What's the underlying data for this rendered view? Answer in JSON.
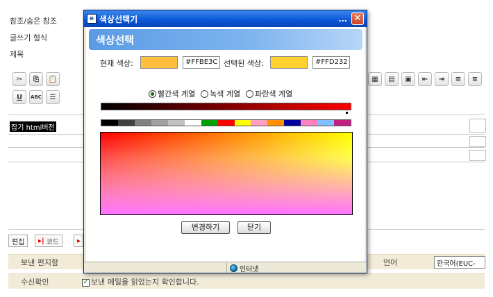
{
  "background": {
    "labels": [
      "참조/숨은 참조",
      "글쓰기 형식",
      "제목"
    ],
    "html_tag": "잡기 html버전",
    "bottom_tabs": [
      "편집",
      "코드"
    ],
    "sender_editor_label": "보낸 편지함",
    "lang_label": "언어",
    "lang_value": "한국어(EUC-",
    "receipt_label": "수신확인",
    "receipt_text": "보낸 메일을 읽었는지 확인합니다.",
    "receipt_checked": "✓"
  },
  "modal": {
    "window_title": "색상선택기",
    "title_dots": "...",
    "banner_title": "색상선택",
    "current_label": "현재 색상:",
    "current_color": "#FFBE3C",
    "current_hex": "#FFBE3C",
    "selected_label": "선택된 색상:",
    "selected_color": "#FFD232",
    "selected_hex": "#FFD232",
    "radios": [
      {
        "label": "빨간색 계열",
        "checked": true
      },
      {
        "label": "녹색 계열",
        "checked": false
      },
      {
        "label": "파란색 계열",
        "checked": false
      }
    ],
    "palette": [
      "#000000",
      "#404040",
      "#808080",
      "#a0a0a0",
      "#c0c0c0",
      "#ffffff",
      "#00a000",
      "#ff0000",
      "#ffff00",
      "#ffa0c0",
      "#ff9000",
      "#0000a0",
      "#ff80c0",
      "#80c0ff",
      "#c02080"
    ],
    "change_button": "변경하기",
    "close_button": "닫기",
    "status_zone": "인터넷"
  }
}
